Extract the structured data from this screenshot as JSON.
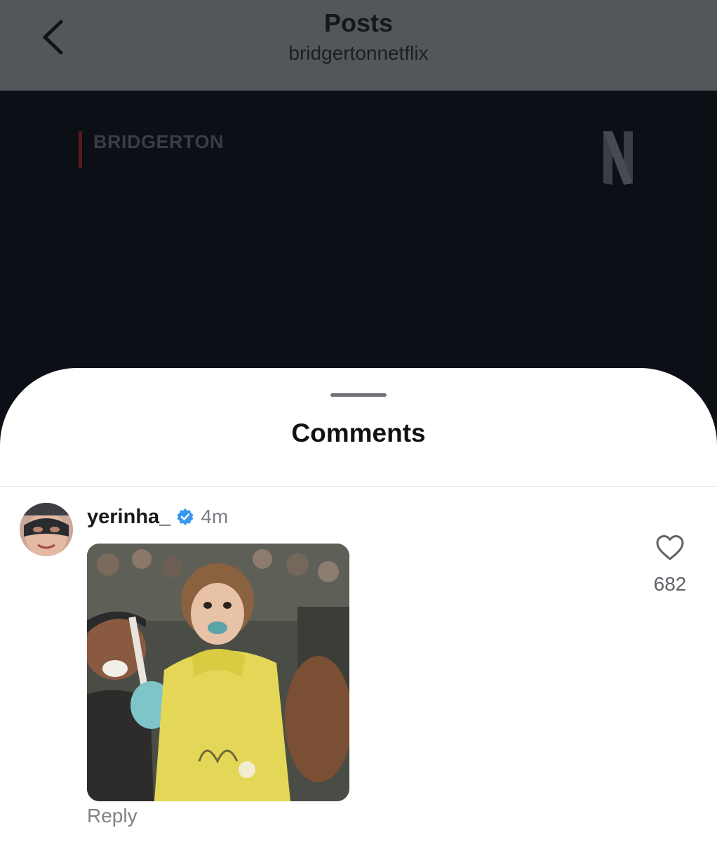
{
  "header": {
    "title": "Posts",
    "subtitle": "bridgertonnetflix",
    "back_icon": "chevron-left-icon"
  },
  "post": {
    "show_name": "BRIDGERTON",
    "brand_logo_letter": "N"
  },
  "comments_sheet": {
    "title": "Comments",
    "comments": [
      {
        "username": "yerinha_",
        "verified": true,
        "time": "4m",
        "like_count": "682",
        "reply_label": "Reply",
        "attachment": "gif"
      }
    ]
  },
  "colors": {
    "header_bg": "#545759",
    "sheet_bg": "#ffffff",
    "verified_blue": "#3897f0",
    "media_bg": "#0c0f16"
  }
}
